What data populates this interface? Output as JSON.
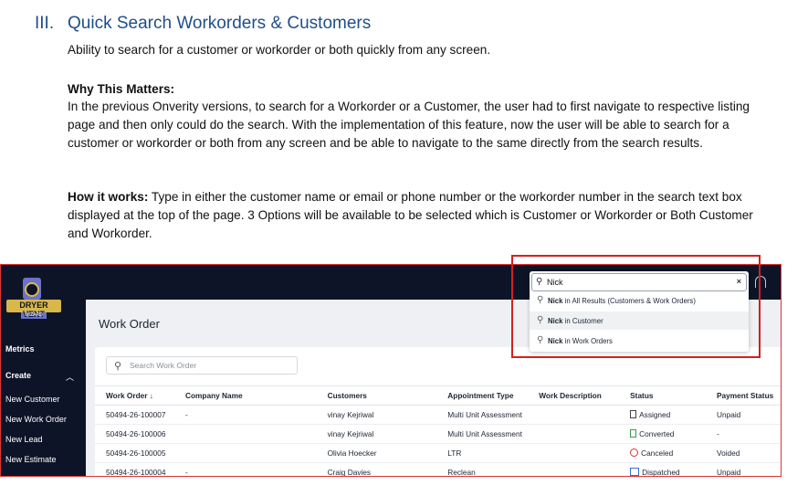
{
  "section": {
    "number": "III.",
    "title": "Quick Search Workorders & Customers",
    "intro": "Ability to search for a customer or workorder or both quickly from any screen.",
    "why_heading": "Why This Matters:",
    "why_body": "In the previous Onverity versions, to search for a Workorder or a Customer, the user had to first navigate to respective listing page and then only could do the search. With the implementation of this feature, now the user will be able to search for a customer or workorder or both from any screen and be able to navigate to the same directly from the search results.",
    "how_heading": "How it works:",
    "how_body": " Type in either the customer name or email or phone number or the workorder number in the search text box displayed at the top of the page. 3 Options will be available to be selected which is Customer or Workorder or Both Customer and Workorder."
  },
  "app": {
    "logo_text": "DRYER VENT",
    "logo_sub": "WIZARD",
    "sidebar": {
      "metrics": "Metrics",
      "create": "Create",
      "items": [
        "New Customer",
        "New Work Order",
        "New Lead",
        "New Estimate"
      ]
    },
    "page_title": "Work Order",
    "search_placeholder": "Search Work Order",
    "columns": [
      "Work Order ↓",
      "Company Name",
      "Customers",
      "Appointment Type",
      "Work Description",
      "Status",
      "Payment Status"
    ],
    "rows": [
      {
        "wo": "50494-26-100007",
        "company": "-",
        "customer": "vinay Kejriwal",
        "appt": "Multi Unit Assessment",
        "desc": "",
        "status": "Assigned",
        "payment": "Unpaid"
      },
      {
        "wo": "50494-26-100006",
        "company": "",
        "customer": "vinay Kejriwal",
        "appt": "Multi Unit Assessment",
        "desc": "",
        "status": "Converted",
        "payment": "-"
      },
      {
        "wo": "50494-26-100005",
        "company": "",
        "customer": "Olivia Hoecker",
        "appt": "LTR",
        "desc": "",
        "status": "Canceled",
        "payment": "Voided"
      },
      {
        "wo": "50494-26-100004",
        "company": "-",
        "customer": "Craig Davies",
        "appt": "Reclean",
        "desc": "",
        "status": "Dispatched",
        "payment": "Unpaid"
      }
    ],
    "global_search": {
      "value": "Nick",
      "clear": "×",
      "options": [
        {
          "term": "Nick",
          "scope": " in All Results (Customers & Work Orders)"
        },
        {
          "term": "Nick",
          "scope": " in Customer"
        },
        {
          "term": "Nick",
          "scope": " in Work Orders"
        }
      ]
    }
  },
  "colors": {
    "heading": "#1f4e8c",
    "sidebar": "#0e1428",
    "highlight": "#d32020"
  }
}
